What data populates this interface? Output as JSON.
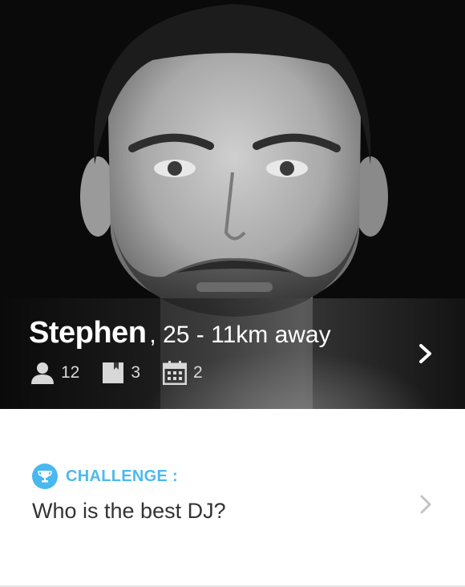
{
  "profile": {
    "name": "Stephen",
    "details": ", 25 - 11km away",
    "photo_description_icon": "portrait-photo",
    "stats": [
      {
        "icon": "person-icon",
        "value": "12"
      },
      {
        "icon": "book-icon",
        "value": "3"
      },
      {
        "icon": "calendar-icon",
        "value": "2"
      }
    ]
  },
  "challenge": {
    "label": "CHALLENGE :",
    "text": "Who is the best DJ?",
    "icon": "trophy-icon"
  },
  "colors": {
    "accent": "#49b8ee",
    "text_dark": "#333333"
  }
}
